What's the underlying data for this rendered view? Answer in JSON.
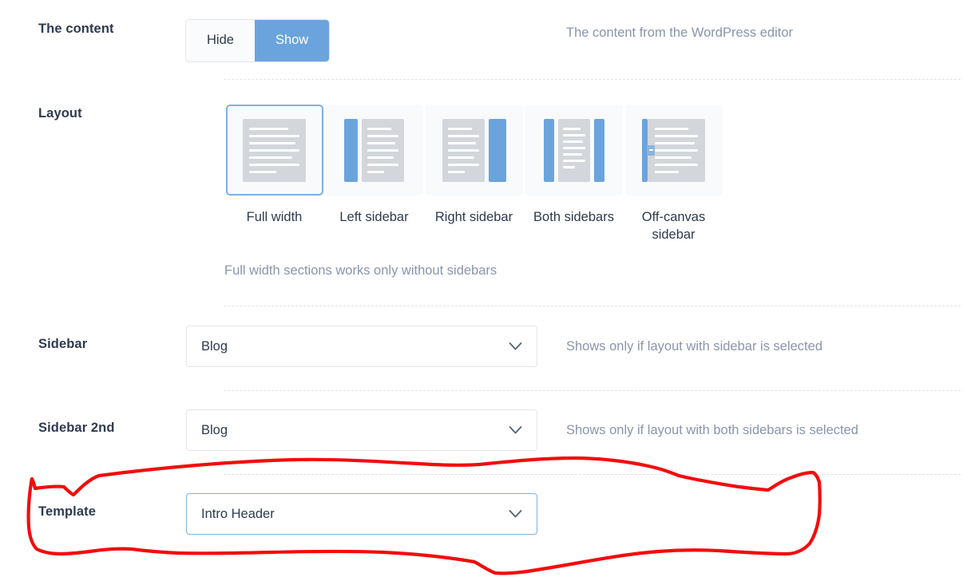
{
  "rows": {
    "content": {
      "label": "The content",
      "help": "The content from the WordPress editor",
      "options": [
        {
          "label": "Hide",
          "selected": false
        },
        {
          "label": "Show",
          "selected": true
        }
      ]
    },
    "layout": {
      "label": "Layout",
      "help": "Full width sections works only without sidebars",
      "thumbs": [
        {
          "label": "Full width",
          "selected": true
        },
        {
          "label": "Left sidebar",
          "selected": false
        },
        {
          "label": "Right sidebar",
          "selected": false
        },
        {
          "label": "Both sidebars",
          "selected": false
        },
        {
          "label": "Off-canvas sidebar",
          "selected": false
        }
      ]
    },
    "sidebar": {
      "label": "Sidebar",
      "value": "Blog",
      "help": "Shows only if layout with sidebar is selected"
    },
    "sidebar2": {
      "label": "Sidebar 2nd",
      "value": "Blog",
      "help": "Shows only if layout with both sidebars is selected"
    },
    "template": {
      "label": "Template",
      "value": "Intro Header",
      "help": ""
    }
  },
  "icons": {
    "chevron": "chevron-down-icon",
    "offcanvas_handle": "offcanvas-handle-arrow-icon",
    "annotation": "red-handdrawn-highlight-loop"
  },
  "colors": {
    "accent": "#6ba4dd",
    "accent_border": "#7eb1e4",
    "label_text": "#2e3a4d",
    "help_text": "#8b94ab",
    "thumb_bg": "#f8fafc",
    "doc_gray": "#d3d6da",
    "divider": "#dfe3e8",
    "annotation": "#f20d0d"
  }
}
